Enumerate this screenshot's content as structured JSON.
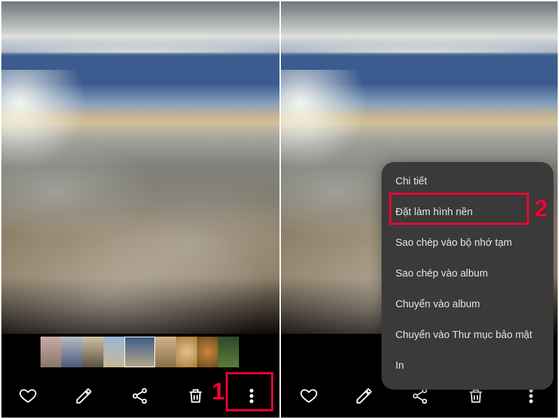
{
  "annotations": {
    "step1": "1",
    "step2": "2"
  },
  "left": {
    "toolbar": {
      "favorite": "favorite",
      "edit": "edit",
      "share": "share",
      "delete": "delete",
      "more": "more"
    }
  },
  "right": {
    "toolbar": {
      "favorite": "favorite",
      "edit": "edit",
      "share": "share",
      "delete": "delete",
      "more": "more"
    },
    "menu": {
      "items": [
        "Chi tiết",
        "Đặt làm hình nền",
        "Sao chép vào bộ nhớ tạm",
        "Sao chép vào album",
        "Chuyển vào album",
        "Chuyển vào Thư mục bảo mật",
        "In"
      ]
    }
  }
}
